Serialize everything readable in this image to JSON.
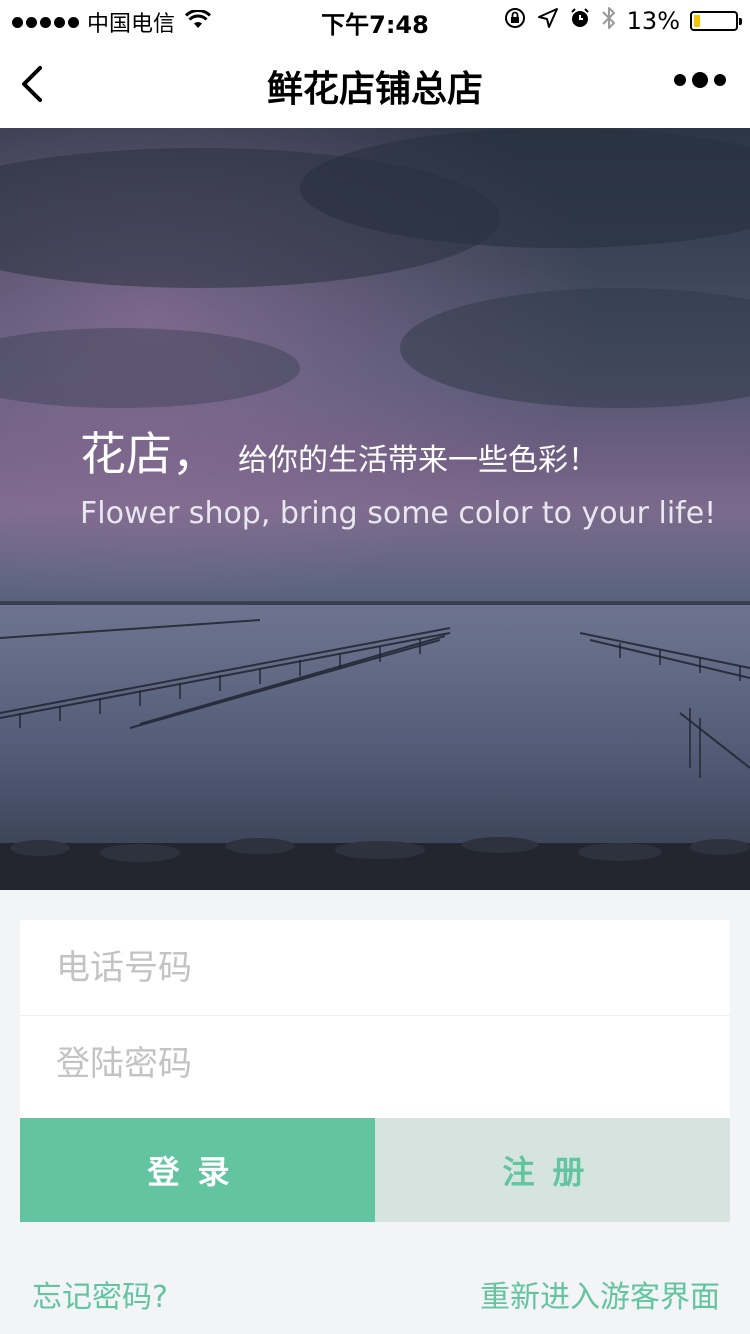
{
  "status_bar": {
    "carrier": "中国电信",
    "time": "下午7:48",
    "battery_percent": "13%",
    "battery_level": 0.13,
    "icons": [
      "signal-dots",
      "wifi-icon",
      "orientation-lock-icon",
      "location-icon",
      "alarm-icon",
      "bluetooth-icon",
      "battery-icon"
    ]
  },
  "nav": {
    "title": "鲜花店铺总店",
    "back_icon": "chevron-left-icon",
    "more_icon": "more-dots-icon"
  },
  "hero": {
    "headline_big": "花店，",
    "headline_small": "给你的生活带来一些色彩！",
    "subtitle": "Flower shop, bring some color to your life!"
  },
  "form": {
    "phone_placeholder": "电话号码",
    "password_placeholder": "登陆密码"
  },
  "buttons": {
    "login": "登录",
    "register": "注册"
  },
  "links": {
    "forgot_password": "忘记密码?",
    "guest_mode": "重新进入游客界面"
  },
  "colors": {
    "accent": "#63c4a2",
    "register_bg": "#d6e4df",
    "page_bg": "#f3f4f6"
  }
}
